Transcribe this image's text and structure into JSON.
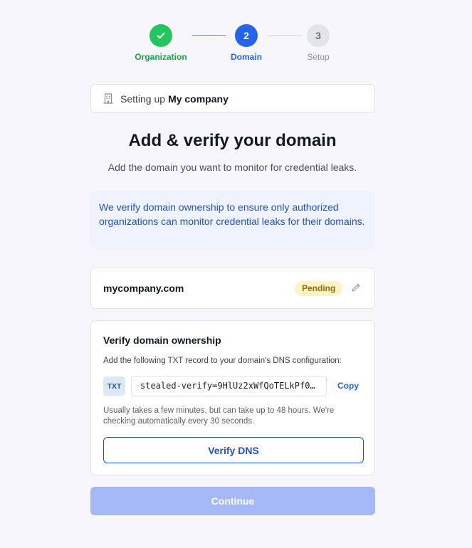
{
  "stepper": {
    "steps": [
      {
        "number": "1",
        "label": "Organization",
        "state": "complete"
      },
      {
        "number": "2",
        "label": "Domain",
        "state": "active"
      },
      {
        "number": "3",
        "label": "Setup",
        "state": "upcoming"
      }
    ]
  },
  "org": {
    "prefix": "Setting up",
    "company": "My company"
  },
  "header": {
    "title": "Add & verify your domain",
    "subtitle": "Add the domain you want to monitor for credential leaks."
  },
  "info": {
    "text": "We verify domain ownership to ensure only authorized organizations can monitor credential leaks for their domains."
  },
  "domain": {
    "name": "mycompany.com",
    "status": "Pending"
  },
  "verify": {
    "title": "Verify domain ownership",
    "description": "Add the following TXT record to your domain's DNS configuration:",
    "record_type": "TXT",
    "record_value": "stealed-verify=9HlUz2xWfQoTELkPf0…",
    "copy_label": "Copy",
    "note": "Usually takes a few minutes, but can take up to 48 hours. We're checking automatically every 30 seconds.",
    "button_label": "Verify DNS"
  },
  "footer": {
    "continue_label": "Continue"
  },
  "colors": {
    "success": "#22c55e",
    "primary": "#2563eb",
    "pending_bg": "#fdf3c4",
    "disabled_button": "#a3b8f5"
  }
}
